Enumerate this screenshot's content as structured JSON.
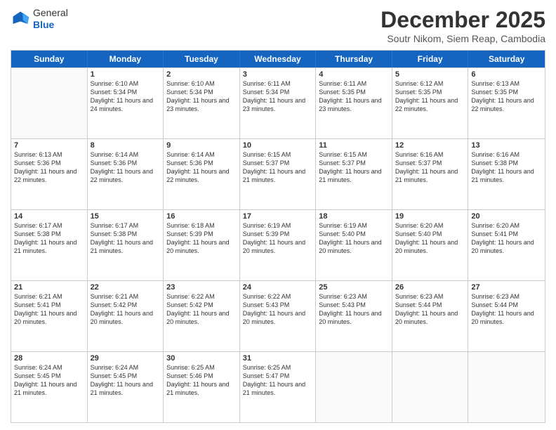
{
  "header": {
    "logo_general": "General",
    "logo_blue": "Blue",
    "title": "December 2025",
    "subtitle": "Soutr Nikom, Siem Reap, Cambodia"
  },
  "days_of_week": [
    "Sunday",
    "Monday",
    "Tuesday",
    "Wednesday",
    "Thursday",
    "Friday",
    "Saturday"
  ],
  "weeks": [
    [
      {
        "day": "",
        "empty": true
      },
      {
        "day": "1",
        "sunrise": "Sunrise: 6:10 AM",
        "sunset": "Sunset: 5:34 PM",
        "daylight": "Daylight: 11 hours and 24 minutes."
      },
      {
        "day": "2",
        "sunrise": "Sunrise: 6:10 AM",
        "sunset": "Sunset: 5:34 PM",
        "daylight": "Daylight: 11 hours and 23 minutes."
      },
      {
        "day": "3",
        "sunrise": "Sunrise: 6:11 AM",
        "sunset": "Sunset: 5:34 PM",
        "daylight": "Daylight: 11 hours and 23 minutes."
      },
      {
        "day": "4",
        "sunrise": "Sunrise: 6:11 AM",
        "sunset": "Sunset: 5:35 PM",
        "daylight": "Daylight: 11 hours and 23 minutes."
      },
      {
        "day": "5",
        "sunrise": "Sunrise: 6:12 AM",
        "sunset": "Sunset: 5:35 PM",
        "daylight": "Daylight: 11 hours and 22 minutes."
      },
      {
        "day": "6",
        "sunrise": "Sunrise: 6:13 AM",
        "sunset": "Sunset: 5:35 PM",
        "daylight": "Daylight: 11 hours and 22 minutes."
      }
    ],
    [
      {
        "day": "7",
        "sunrise": "Sunrise: 6:13 AM",
        "sunset": "Sunset: 5:36 PM",
        "daylight": "Daylight: 11 hours and 22 minutes."
      },
      {
        "day": "8",
        "sunrise": "Sunrise: 6:14 AM",
        "sunset": "Sunset: 5:36 PM",
        "daylight": "Daylight: 11 hours and 22 minutes."
      },
      {
        "day": "9",
        "sunrise": "Sunrise: 6:14 AM",
        "sunset": "Sunset: 5:36 PM",
        "daylight": "Daylight: 11 hours and 22 minutes."
      },
      {
        "day": "10",
        "sunrise": "Sunrise: 6:15 AM",
        "sunset": "Sunset: 5:37 PM",
        "daylight": "Daylight: 11 hours and 21 minutes."
      },
      {
        "day": "11",
        "sunrise": "Sunrise: 6:15 AM",
        "sunset": "Sunset: 5:37 PM",
        "daylight": "Daylight: 11 hours and 21 minutes."
      },
      {
        "day": "12",
        "sunrise": "Sunrise: 6:16 AM",
        "sunset": "Sunset: 5:37 PM",
        "daylight": "Daylight: 11 hours and 21 minutes."
      },
      {
        "day": "13",
        "sunrise": "Sunrise: 6:16 AM",
        "sunset": "Sunset: 5:38 PM",
        "daylight": "Daylight: 11 hours and 21 minutes."
      }
    ],
    [
      {
        "day": "14",
        "sunrise": "Sunrise: 6:17 AM",
        "sunset": "Sunset: 5:38 PM",
        "daylight": "Daylight: 11 hours and 21 minutes."
      },
      {
        "day": "15",
        "sunrise": "Sunrise: 6:17 AM",
        "sunset": "Sunset: 5:38 PM",
        "daylight": "Daylight: 11 hours and 21 minutes."
      },
      {
        "day": "16",
        "sunrise": "Sunrise: 6:18 AM",
        "sunset": "Sunset: 5:39 PM",
        "daylight": "Daylight: 11 hours and 20 minutes."
      },
      {
        "day": "17",
        "sunrise": "Sunrise: 6:19 AM",
        "sunset": "Sunset: 5:39 PM",
        "daylight": "Daylight: 11 hours and 20 minutes."
      },
      {
        "day": "18",
        "sunrise": "Sunrise: 6:19 AM",
        "sunset": "Sunset: 5:40 PM",
        "daylight": "Daylight: 11 hours and 20 minutes."
      },
      {
        "day": "19",
        "sunrise": "Sunrise: 6:20 AM",
        "sunset": "Sunset: 5:40 PM",
        "daylight": "Daylight: 11 hours and 20 minutes."
      },
      {
        "day": "20",
        "sunrise": "Sunrise: 6:20 AM",
        "sunset": "Sunset: 5:41 PM",
        "daylight": "Daylight: 11 hours and 20 minutes."
      }
    ],
    [
      {
        "day": "21",
        "sunrise": "Sunrise: 6:21 AM",
        "sunset": "Sunset: 5:41 PM",
        "daylight": "Daylight: 11 hours and 20 minutes."
      },
      {
        "day": "22",
        "sunrise": "Sunrise: 6:21 AM",
        "sunset": "Sunset: 5:42 PM",
        "daylight": "Daylight: 11 hours and 20 minutes."
      },
      {
        "day": "23",
        "sunrise": "Sunrise: 6:22 AM",
        "sunset": "Sunset: 5:42 PM",
        "daylight": "Daylight: 11 hours and 20 minutes."
      },
      {
        "day": "24",
        "sunrise": "Sunrise: 6:22 AM",
        "sunset": "Sunset: 5:43 PM",
        "daylight": "Daylight: 11 hours and 20 minutes."
      },
      {
        "day": "25",
        "sunrise": "Sunrise: 6:23 AM",
        "sunset": "Sunset: 5:43 PM",
        "daylight": "Daylight: 11 hours and 20 minutes."
      },
      {
        "day": "26",
        "sunrise": "Sunrise: 6:23 AM",
        "sunset": "Sunset: 5:44 PM",
        "daylight": "Daylight: 11 hours and 20 minutes."
      },
      {
        "day": "27",
        "sunrise": "Sunrise: 6:23 AM",
        "sunset": "Sunset: 5:44 PM",
        "daylight": "Daylight: 11 hours and 20 minutes."
      }
    ],
    [
      {
        "day": "28",
        "sunrise": "Sunrise: 6:24 AM",
        "sunset": "Sunset: 5:45 PM",
        "daylight": "Daylight: 11 hours and 21 minutes."
      },
      {
        "day": "29",
        "sunrise": "Sunrise: 6:24 AM",
        "sunset": "Sunset: 5:45 PM",
        "daylight": "Daylight: 11 hours and 21 minutes."
      },
      {
        "day": "30",
        "sunrise": "Sunrise: 6:25 AM",
        "sunset": "Sunset: 5:46 PM",
        "daylight": "Daylight: 11 hours and 21 minutes."
      },
      {
        "day": "31",
        "sunrise": "Sunrise: 6:25 AM",
        "sunset": "Sunset: 5:47 PM",
        "daylight": "Daylight: 11 hours and 21 minutes."
      },
      {
        "day": "",
        "empty": true
      },
      {
        "day": "",
        "empty": true
      },
      {
        "day": "",
        "empty": true
      }
    ]
  ]
}
